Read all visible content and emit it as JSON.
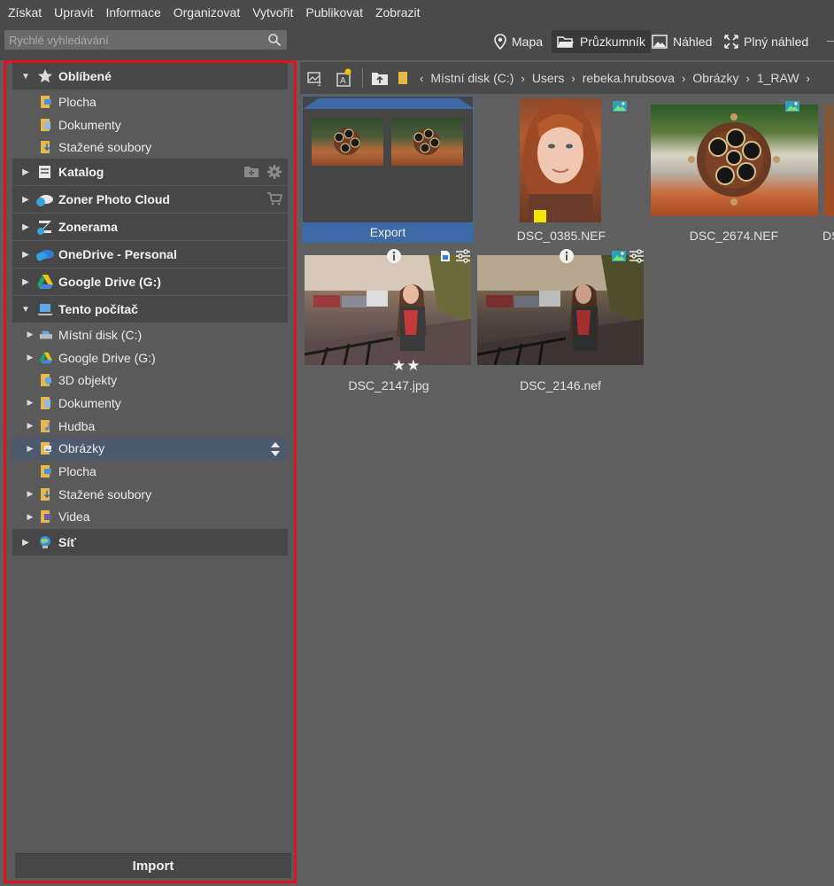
{
  "menu": [
    "Získat",
    "Upravit",
    "Informace",
    "Organizovat",
    "Vytvořit",
    "Publikovat",
    "Zobrazit"
  ],
  "search": {
    "placeholder": "Rychlé vyhledávání"
  },
  "views": {
    "map": "Mapa",
    "explorer": "Průzkumník",
    "preview": "Náhled",
    "fullscreen": "Plný náhled"
  },
  "sidebar": {
    "favorites": {
      "label": "Oblíbené",
      "items": [
        "Plocha",
        "Dokumenty",
        "Stažené soubory"
      ]
    },
    "catalog": "Katalog",
    "cloud": "Zoner Photo Cloud",
    "zonerama": "Zonerama",
    "onedrive": "OneDrive - Personal",
    "gdrive": "Google Drive (G:)",
    "pc": {
      "label": "Tento počítač",
      "items": [
        "Místní disk (C:)",
        "Google Drive (G:)",
        "3D objekty",
        "Dokumenty",
        "Hudba",
        "Obrázky",
        "Plocha",
        "Stažené soubory",
        "Videa"
      ]
    },
    "network": "Síť",
    "import": "Import"
  },
  "breadcrumb": [
    "Místní disk (C:)",
    "Users",
    "rebeka.hrubsova",
    "Obrázky",
    "1_RAW"
  ],
  "files": {
    "folder": "Export",
    "f1": "DSC_0385.NEF",
    "f2": "DSC_2674.NEF",
    "f3": "DS",
    "f4": "DSC_2147.jpg",
    "f5": "DSC_2146.nef"
  },
  "ratings": {
    "DSC_2147.jpg": 2
  },
  "colors": {
    "accent": "#3d6aa6",
    "highlight": "#e0141c",
    "label_yellow": "#f2e600"
  }
}
